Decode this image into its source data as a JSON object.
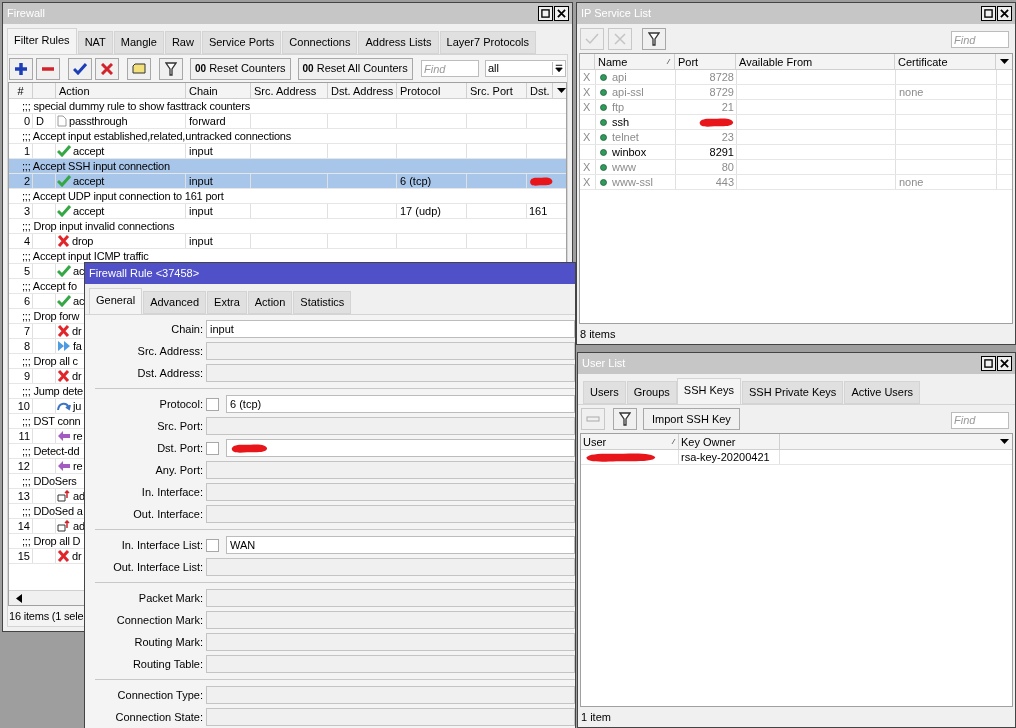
{
  "firewall": {
    "title": "Firewall",
    "active": false,
    "tabs": [
      {
        "label": "Filter Rules",
        "selected": true
      },
      {
        "label": "NAT",
        "selected": false
      },
      {
        "label": "Mangle",
        "selected": false
      },
      {
        "label": "Raw",
        "selected": false
      },
      {
        "label": "Service Ports",
        "selected": false
      },
      {
        "label": "Connections",
        "selected": false
      },
      {
        "label": "Address Lists",
        "selected": false
      },
      {
        "label": "Layer7 Protocols",
        "selected": false
      }
    ],
    "toolbar": [
      {
        "kind": "add",
        "disabled": false
      },
      {
        "kind": "remove",
        "disabled": false
      },
      {
        "kind": "enable",
        "disabled": false
      },
      {
        "kind": "disable",
        "disabled": false
      },
      {
        "kind": "comment",
        "disabled": false
      },
      {
        "kind": "filter",
        "disabled": false
      }
    ],
    "counter_buttons": [
      {
        "prefix": "00",
        "label": "Reset Counters"
      },
      {
        "prefix": "00",
        "label": "Reset All Counters"
      }
    ],
    "find": {
      "placeholder": "Find"
    },
    "filter": {
      "value": "all"
    },
    "columns": [
      "#",
      "Action",
      "Chain",
      "Src. Address",
      "Dst. Address",
      "Protocol",
      "Src. Port",
      "Dst."
    ],
    "rows": [
      {
        "kind": "comment",
        "text": ";;; special dummy rule to show fasttrack counters",
        "selected": false
      },
      {
        "kind": "rule",
        "number": "0",
        "flag": "D",
        "action": {
          "kind": "passthrough",
          "text": "passthrough"
        },
        "chain": "forward",
        "selected": false
      },
      {
        "kind": "comment",
        "text": ";;; Accept input established,related,untracked connections",
        "selected": false
      },
      {
        "kind": "rule",
        "number": "1",
        "action": {
          "kind": "accept",
          "text": "accept"
        },
        "chain": "input",
        "selected": false
      },
      {
        "kind": "comment",
        "text": ";;; Accept SSH input connection",
        "selected": true
      },
      {
        "kind": "rule",
        "number": "2",
        "action": {
          "kind": "accept",
          "text": "accept"
        },
        "chain": "input",
        "protocol": "6 (tcp)",
        "dst_port_redacted": true,
        "selected": true
      },
      {
        "kind": "comment",
        "text": ";;; Accept UDP input connection to 161 port",
        "selected": false
      },
      {
        "kind": "rule",
        "number": "3",
        "action": {
          "kind": "accept",
          "text": "accept"
        },
        "chain": "input",
        "protocol": "17 (udp)",
        "dst_port": "161",
        "selected": false
      },
      {
        "kind": "comment",
        "text": ";;; Drop input invalid connections",
        "selected": false
      },
      {
        "kind": "rule",
        "number": "4",
        "action": {
          "kind": "drop",
          "text": "drop"
        },
        "chain": "input",
        "selected": false
      },
      {
        "kind": "comment",
        "text": ";;; Accept input ICMP traffic",
        "selected": false
      },
      {
        "kind": "rule",
        "number": "5",
        "action": {
          "kind": "accept",
          "text": "ac"
        },
        "selected": false
      },
      {
        "kind": "comment",
        "text": ";;; Accept fo",
        "selected": false
      },
      {
        "kind": "rule",
        "number": "6",
        "action": {
          "kind": "accept",
          "text": "ac"
        },
        "selected": false
      },
      {
        "kind": "comment",
        "text": ";;; Drop forw",
        "selected": false
      },
      {
        "kind": "rule",
        "number": "7",
        "action": {
          "kind": "drop",
          "text": "dr"
        },
        "selected": false
      },
      {
        "kind": "rule",
        "number": "8",
        "action": {
          "kind": "fasttrack",
          "text": "fa"
        },
        "selected": false
      },
      {
        "kind": "comment",
        "text": ";;; Drop all c",
        "selected": false
      },
      {
        "kind": "rule",
        "number": "9",
        "action": {
          "kind": "drop",
          "text": "dr"
        },
        "selected": false
      },
      {
        "kind": "comment",
        "text": ";;; Jump dete",
        "selected": false
      },
      {
        "kind": "rule",
        "number": "10",
        "action": {
          "kind": "jump",
          "text": "ju"
        },
        "selected": false
      },
      {
        "kind": "comment",
        "text": ";;; DST conn",
        "selected": false
      },
      {
        "kind": "rule",
        "number": "11",
        "action": {
          "kind": "return",
          "text": "re"
        },
        "selected": false
      },
      {
        "kind": "comment",
        "text": ";;; Detect-dd",
        "selected": false
      },
      {
        "kind": "rule",
        "number": "12",
        "action": {
          "kind": "return",
          "text": "re"
        },
        "selected": false
      },
      {
        "kind": "comment",
        "text": ";;; DDoSers",
        "selected": false
      },
      {
        "kind": "rule",
        "number": "13",
        "action": {
          "kind": "add",
          "text": "ad"
        },
        "selected": false
      },
      {
        "kind": "comment",
        "text": ";;; DDoSed a",
        "selected": false
      },
      {
        "kind": "rule",
        "number": "14",
        "action": {
          "kind": "add",
          "text": "ad"
        },
        "selected": false
      },
      {
        "kind": "comment",
        "text": ";;; Drop all D",
        "selected": false
      },
      {
        "kind": "rule",
        "number": "15",
        "action": {
          "kind": "drop",
          "text": "dr"
        },
        "selected": false
      }
    ],
    "status": "16 items (1 sele"
  },
  "rule_dialog": {
    "title": "Firewall Rule <37458>",
    "active": true,
    "tabs": [
      {
        "label": "General",
        "selected": true
      },
      {
        "label": "Advanced",
        "selected": false
      },
      {
        "label": "Extra",
        "selected": false
      },
      {
        "label": "Action",
        "selected": false
      },
      {
        "label": "Statistics",
        "selected": false
      }
    ],
    "groups": [
      [
        {
          "label": "Chain:",
          "kind": "text",
          "value": "input"
        },
        {
          "label": "Src. Address:",
          "kind": "empty"
        },
        {
          "label": "Dst. Address:",
          "kind": "empty"
        }
      ],
      [
        {
          "label": "Protocol:",
          "kind": "negatable",
          "checked": false,
          "value": "6 (tcp)"
        },
        {
          "label": "Src. Port:",
          "kind": "empty"
        },
        {
          "label": "Dst. Port:",
          "kind": "negatable",
          "checked": false,
          "redacted": true
        },
        {
          "label": "Any. Port:",
          "kind": "empty"
        },
        {
          "label": "In. Interface:",
          "kind": "empty"
        },
        {
          "label": "Out. Interface:",
          "kind": "empty"
        }
      ],
      [
        {
          "label": "In. Interface List:",
          "kind": "negatable",
          "checked": false,
          "value": "WAN"
        },
        {
          "label": "Out. Interface List:",
          "kind": "empty"
        }
      ],
      [
        {
          "label": "Packet Mark:",
          "kind": "empty"
        },
        {
          "label": "Connection Mark:",
          "kind": "empty"
        },
        {
          "label": "Routing Mark:",
          "kind": "empty"
        },
        {
          "label": "Routing Table:",
          "kind": "empty"
        }
      ],
      [
        {
          "label": "Connection Type:",
          "kind": "empty"
        },
        {
          "label": "Connection State:",
          "kind": "empty"
        }
      ]
    ]
  },
  "ip_services": {
    "title": "IP Service List",
    "active": false,
    "toolbar": [
      {
        "kind": "enable",
        "disabled": true
      },
      {
        "kind": "disable",
        "disabled": true
      },
      {
        "kind": "filter",
        "disabled": false
      }
    ],
    "find": {
      "placeholder": "Find"
    },
    "columns": [
      "Name",
      "Port",
      "Available From",
      "Certificate"
    ],
    "rows": [
      {
        "flag": "X",
        "disabled": true,
        "name": "api",
        "port": "8728",
        "selected": false
      },
      {
        "flag": "X",
        "disabled": true,
        "name": "api-ssl",
        "port": "8729",
        "certificate": "none",
        "selected": false
      },
      {
        "flag": "X",
        "disabled": true,
        "name": "ftp",
        "port": "21",
        "selected": false
      },
      {
        "disabled": false,
        "name": "ssh",
        "port_redacted": true,
        "selected": false
      },
      {
        "flag": "X",
        "disabled": true,
        "name": "telnet",
        "port": "23",
        "selected": false
      },
      {
        "disabled": false,
        "name": "winbox",
        "port": "8291",
        "selected": false
      },
      {
        "flag": "X",
        "disabled": true,
        "name": "www",
        "port": "80",
        "selected": false
      },
      {
        "flag": "X",
        "disabled": true,
        "name": "www-ssl",
        "port": "443",
        "certificate": "none",
        "selected": false
      }
    ],
    "status": "8 items"
  },
  "user_list": {
    "title": "User List",
    "active": false,
    "tabs": [
      {
        "label": "Users",
        "selected": false
      },
      {
        "label": "Groups",
        "selected": false
      },
      {
        "label": "SSH Keys",
        "selected": true
      },
      {
        "label": "SSH Private Keys",
        "selected": false
      },
      {
        "label": "Active Users",
        "selected": false
      }
    ],
    "toolbar": [
      {
        "kind": "remove",
        "disabled": true
      },
      {
        "kind": "filter",
        "disabled": false
      }
    ],
    "import_button": "Import SSH Key",
    "find": {
      "placeholder": "Find"
    },
    "columns": [
      "User",
      "Key Owner"
    ],
    "rows": [
      {
        "user_redacted": true,
        "key_owner": "rsa-key-20200421",
        "selected": false
      }
    ],
    "status": "1 item"
  }
}
